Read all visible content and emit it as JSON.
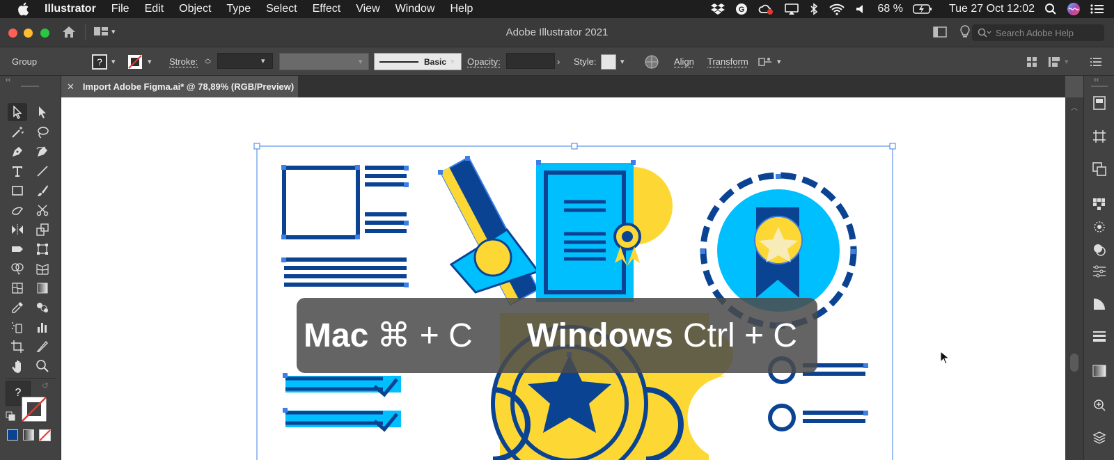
{
  "menubar": {
    "app_name": "Illustrator",
    "menus": [
      "File",
      "Edit",
      "Object",
      "Type",
      "Select",
      "Effect",
      "View",
      "Window",
      "Help"
    ],
    "battery": "68 %",
    "clock": "Tue 27 Oct  12:02"
  },
  "window": {
    "title": "Adobe Illustrator 2021",
    "search_placeholder": "Search Adobe Help"
  },
  "controlbar": {
    "selection": "Group",
    "fill_label": "?",
    "stroke_label": "Stroke:",
    "brush_label": "Basic",
    "opacity_label": "Opacity:",
    "style_label": "Style:",
    "align_label": "Align",
    "transform_label": "Transform"
  },
  "document": {
    "tab_title": "Import Adobe Figma.ai* @ 78,89% (RGB/Preview)"
  },
  "toolbar": {
    "fill_indicator": "?"
  },
  "banner": {
    "mac_label": "Mac",
    "mac_keys": "⌘ + C",
    "win_label": "Windows",
    "win_keys": "Ctrl + C"
  },
  "colors": {
    "navy": "#0b4393",
    "cyan": "#00bfff",
    "yellow": "#fdd835",
    "selection": "#3c7fe6"
  }
}
